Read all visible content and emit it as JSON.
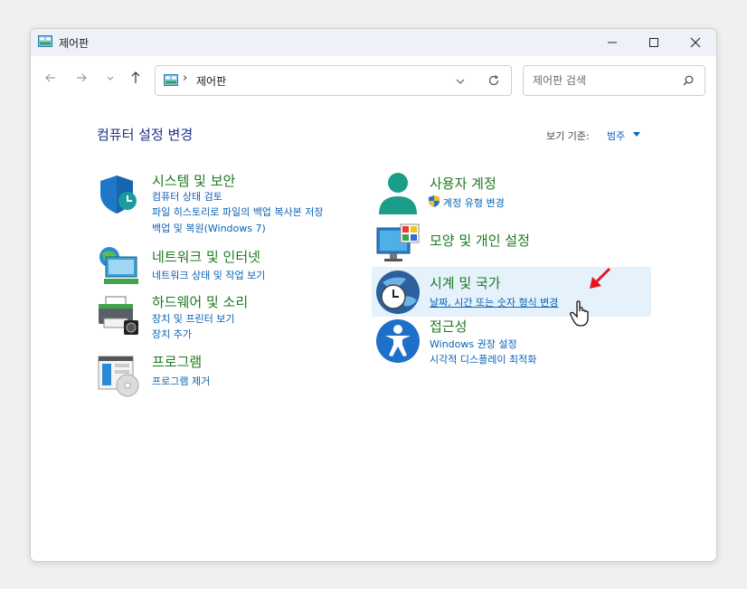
{
  "window": {
    "title": "제어판"
  },
  "title_icon": "control-panel-icon",
  "nav": {
    "back_icon": "arrow-left-icon",
    "forward_icon": "arrow-right-icon",
    "recent_icon": "chevron-down-icon",
    "up_icon": "arrow-up-icon"
  },
  "address": {
    "path": "제어판",
    "separator": "›"
  },
  "search": {
    "placeholder": "제어판 검색",
    "value": ""
  },
  "header": {
    "title": "컴퓨터 설정 변경",
    "view_by_label": "보기 기준:",
    "view_by_value": "범주"
  },
  "categories": [
    {
      "title": "시스템 및 보안",
      "icon": "shield-icon",
      "links": [
        "컴퓨터 상태 검토",
        "파일 히스토리로 파일의 백업 복사본 저장",
        "백업 및 복원(Windows 7)"
      ]
    },
    {
      "title": "네트워크 및 인터넷",
      "icon": "network-globe-icon",
      "links": [
        "네트워크 상태 및 작업 보기"
      ]
    },
    {
      "title": "하드웨어 및 소리",
      "icon": "printer-icon",
      "links": [
        "장치 및 프린터 보기",
        "장치 추가"
      ]
    },
    {
      "title": "프로그램",
      "icon": "programs-icon",
      "links": [
        "프로그램 제거"
      ]
    },
    {
      "title": "사용자 계정",
      "icon": "user-icon",
      "links": [
        "계정 유형 변경"
      ]
    },
    {
      "title": "모양 및 개인 설정",
      "icon": "monitor-icon",
      "links": []
    },
    {
      "title": "시계 및 국가",
      "icon": "clock-globe-icon",
      "links": [
        "날짜, 시간 또는 숫자 형식 변경"
      ]
    },
    {
      "title": "접근성",
      "icon": "accessibility-icon",
      "links": [
        "Windows 권장 설정",
        "시각적 디스플레이 최적화"
      ]
    }
  ],
  "colors": {
    "category_title": "#1e7a1e",
    "link": "#0b63b6",
    "highlight": "#e5f1fb",
    "annotation_arrow": "#e8141c"
  }
}
